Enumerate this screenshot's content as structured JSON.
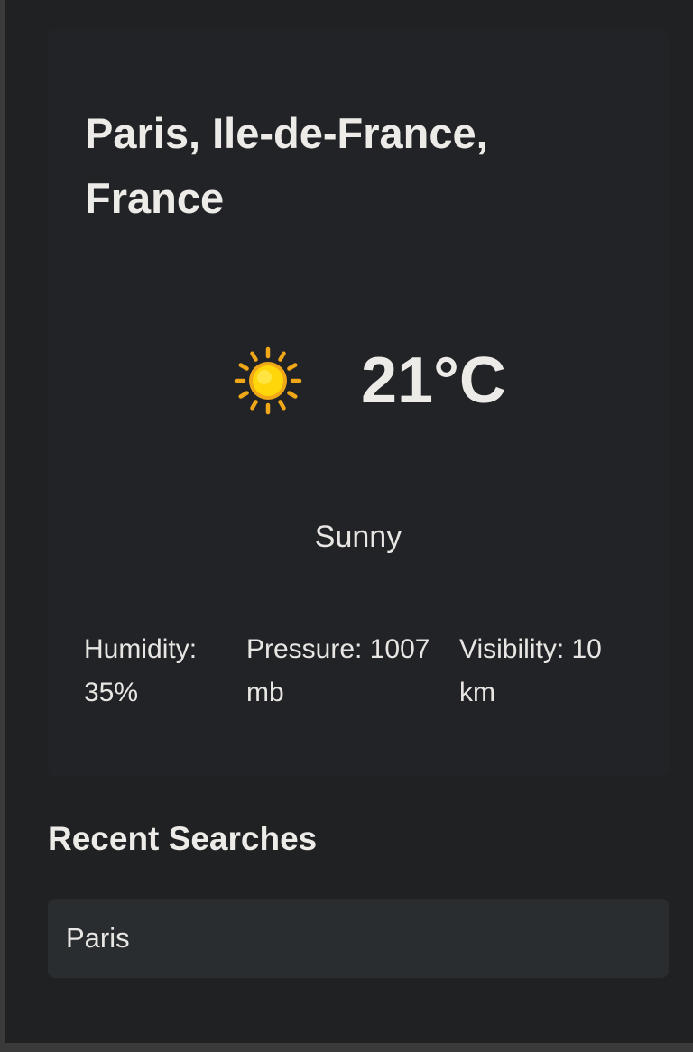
{
  "weather": {
    "location": "Paris, Ile-de-France, France",
    "icon": "sun-icon",
    "temperature": "21°C",
    "condition": "Sunny",
    "stats": {
      "humidity": "Humidity: 35%",
      "pressure": "Pressure: 1007 mb",
      "visibility": "Visibility: 10 km"
    }
  },
  "recent": {
    "title": "Recent Searches",
    "items": [
      "Paris"
    ]
  },
  "colors": {
    "background": "#1f2123",
    "card": "#212326",
    "recent_item": "#2a2d30",
    "sun": "#f5b400",
    "text": "#e8e6e3"
  }
}
